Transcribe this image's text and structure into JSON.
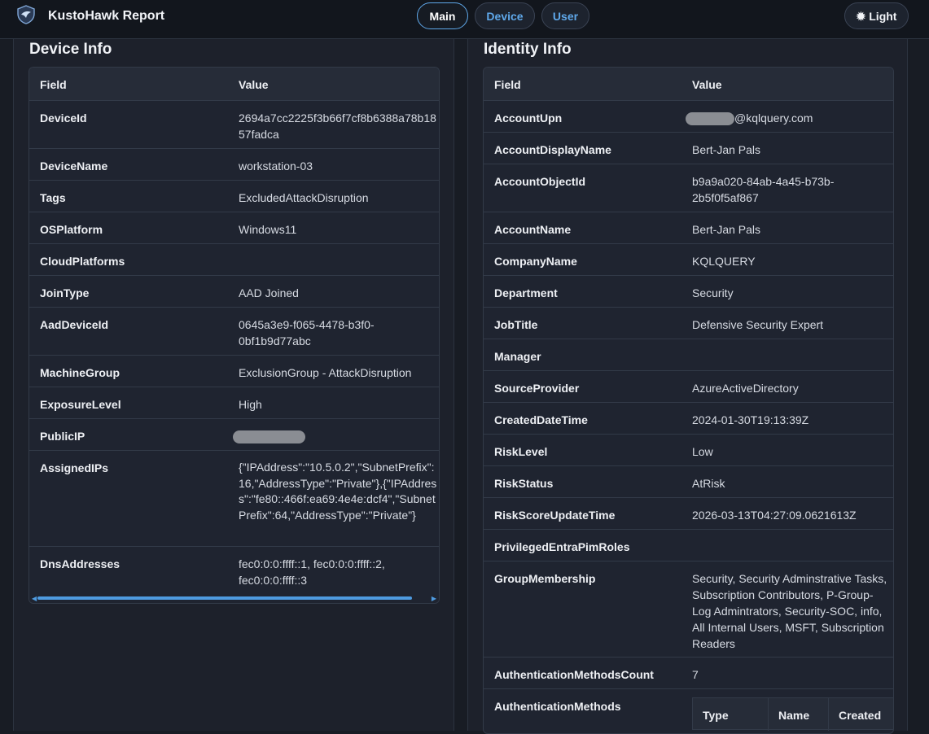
{
  "app": {
    "title": "KustoHawk Report"
  },
  "nav": {
    "main_label": "Main",
    "device_label": "Device",
    "user_label": "User",
    "theme_label": "Light",
    "theme_icon": "sun-icon"
  },
  "device_info": {
    "title": "Device Info",
    "col_field": "Field",
    "col_value": "Value",
    "rows": [
      {
        "field": "DeviceId",
        "value": "2694a7cc2225f3b66f7cf8b6388a78b1857fadca"
      },
      {
        "field": "DeviceName",
        "value": "workstation-03"
      },
      {
        "field": "Tags",
        "value": "ExcludedAttackDisruption"
      },
      {
        "field": "OSPlatform",
        "value": "Windows11"
      },
      {
        "field": "CloudPlatforms",
        "value": ""
      },
      {
        "field": "JoinType",
        "value": "AAD Joined"
      },
      {
        "field": "AadDeviceId",
        "value": "0645a3e9-f065-4478-b3f0-0bf1b9d77abc"
      },
      {
        "field": "MachineGroup",
        "value": "ExclusionGroup - AttackDisruption"
      },
      {
        "field": "ExposureLevel",
        "value": "High"
      },
      {
        "field": "PublicIP",
        "value": ""
      },
      {
        "field": "AssignedIPs",
        "value": "{\"IPAddress\":\"10.5.0.2\",\"SubnetPrefix\":16,\"AddressType\":\"Private\"},{\"IPAddress\":\"fe80::466f:ea69:4e4e:dcf4\",\"SubnetPrefix\":64,\"AddressType\":\"Private\"}"
      },
      {
        "field": "DnsAddresses",
        "value": "fec0:0:0:ffff::1, fec0:0:0:ffff::2, fec0:0:0:ffff::3"
      }
    ]
  },
  "identity_info": {
    "title": "Identity Info",
    "col_field": "Field",
    "col_value": "Value",
    "rows": [
      {
        "field": "AccountUpn",
        "value": "@kqlquery.com"
      },
      {
        "field": "AccountDisplayName",
        "value": "Bert-Jan Pals"
      },
      {
        "field": "AccountObjectId",
        "value": "b9a9a020-84ab-4a45-b73b-2b5f0f5af867"
      },
      {
        "field": "AccountName",
        "value": "Bert-Jan Pals"
      },
      {
        "field": "CompanyName",
        "value": "KQLQUERY"
      },
      {
        "field": "Department",
        "value": "Security"
      },
      {
        "field": "JobTitle",
        "value": "Defensive Security Expert"
      },
      {
        "field": "Manager",
        "value": ""
      },
      {
        "field": "SourceProvider",
        "value": "AzureActiveDirectory"
      },
      {
        "field": "CreatedDateTime",
        "value": "2024-01-30T19:13:39Z"
      },
      {
        "field": "RiskLevel",
        "value": "Low"
      },
      {
        "field": "RiskStatus",
        "value": "AtRisk"
      },
      {
        "field": "RiskScoreUpdateTime",
        "value": "2026-03-13T04:27:09.0621613Z"
      },
      {
        "field": "PrivilegedEntraPimRoles",
        "value": ""
      },
      {
        "field": "GroupMembership",
        "value": "Security, Security Adminstrative Tasks, Subscription Contributors, P-Group-Log Admintrators, Security-SOC, info, All Internal Users, MSFT, Subscription Readers"
      },
      {
        "field": "AuthenticationMethodsCount",
        "value": "7"
      },
      {
        "field": "AuthenticationMethods",
        "value": ""
      }
    ],
    "auth_methods_columns": [
      "Type",
      "Name",
      "Created"
    ]
  }
}
